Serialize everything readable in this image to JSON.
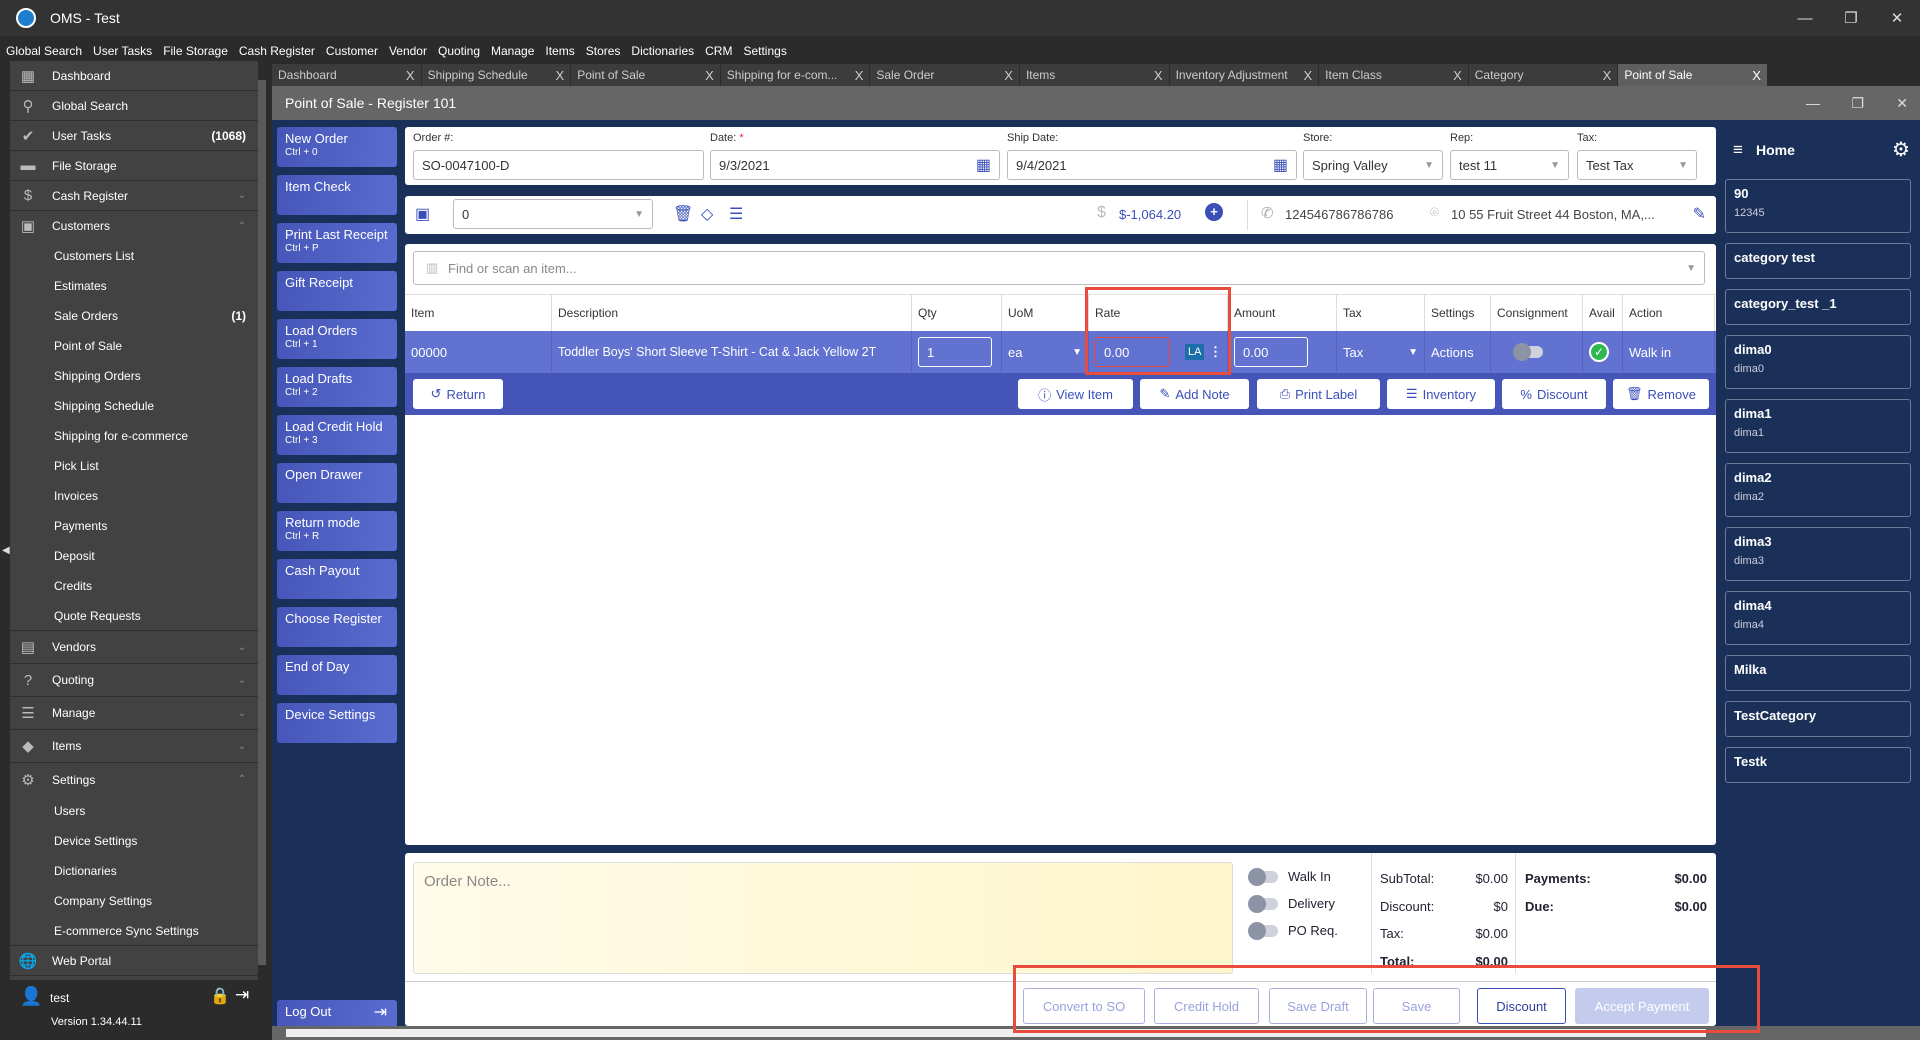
{
  "app": {
    "title": "OMS - Test"
  },
  "menu": [
    "Global Search",
    "User Tasks",
    "File Storage",
    "Cash Register",
    "Customer",
    "Vendor",
    "Quoting",
    "Manage",
    "Items",
    "Stores",
    "Dictionaries",
    "CRM",
    "Settings"
  ],
  "sidebar": {
    "items": [
      {
        "label": "Dashboard",
        "icon": "dashboard-icon",
        "glyph": "▦"
      },
      {
        "label": "Global Search",
        "icon": "search-icon",
        "glyph": "⚲"
      },
      {
        "label": "User Tasks",
        "icon": "check-circle-icon",
        "glyph": "✔",
        "count": "(1068)"
      },
      {
        "label": "File Storage",
        "icon": "folder-icon",
        "glyph": "▬"
      },
      {
        "label": "Cash Register",
        "icon": "dollar-icon",
        "glyph": "$",
        "chev": "⌄"
      }
    ],
    "customers": {
      "label": "Customers",
      "chev": "⌃",
      "subs": [
        "Customers List",
        "Estimates",
        "Sale Orders",
        "Point of Sale",
        "Shipping Orders",
        "Shipping Schedule",
        "Shipping for e-commerce",
        "Pick List",
        "Invoices",
        "Payments",
        "Deposit",
        "Credits",
        "Quote Requests"
      ],
      "sale_orders_count": "(1)"
    },
    "groups": [
      {
        "label": "Vendors",
        "glyph": "▤"
      },
      {
        "label": "Quoting",
        "glyph": "?"
      },
      {
        "label": "Manage",
        "glyph": "☰"
      },
      {
        "label": "Items",
        "glyph": "◆"
      }
    ],
    "settings": {
      "label": "Settings",
      "chev": "⌃",
      "subs": [
        "Users",
        "Device Settings",
        "Dictionaries",
        "Company Settings",
        "E-commerce Sync Settings"
      ]
    },
    "web_portal": "Web Portal",
    "user": "test",
    "version": "Version 1.34.44.11"
  },
  "tabs": [
    "Dashboard",
    "Shipping Schedule",
    "Point of Sale",
    "Shipping for e-com...",
    "Sale Order",
    "Items",
    "Inventory Adjustment",
    "Item Class",
    "Category",
    "Point of Sale"
  ],
  "window": {
    "title": "Point of Sale - Register 101"
  },
  "left_buttons": [
    {
      "label": "New Order",
      "sc": "Ctrl + 0"
    },
    {
      "label": "Item Check",
      "sc": ""
    },
    {
      "label": "Print Last Receipt",
      "sc": "Ctrl + P"
    },
    {
      "label": "Gift Receipt",
      "sc": ""
    },
    {
      "label": "Load Orders",
      "sc": "Ctrl + 1"
    },
    {
      "label": "Load Drafts",
      "sc": "Ctrl + 2"
    },
    {
      "label": "Load Credit Hold",
      "sc": "Ctrl + 3"
    },
    {
      "label": "Open Drawer",
      "sc": ""
    },
    {
      "label": "Return mode",
      "sc": "Ctrl + R"
    },
    {
      "label": "Cash Payout",
      "sc": ""
    },
    {
      "label": "Choose Register",
      "sc": ""
    },
    {
      "label": "End of Day",
      "sc": ""
    },
    {
      "label": "Device Settings",
      "sc": ""
    }
  ],
  "logout": "Log Out",
  "header": {
    "order_label": "Order #:",
    "order": "SO-0047100-D",
    "date_label": "Date:",
    "required": "*",
    "date": "9/3/2021",
    "ship_label": "Ship Date:",
    "ship": "9/4/2021",
    "store_label": "Store:",
    "store": "Spring Valley",
    "rep_label": "Rep:",
    "rep": "test 11",
    "tax_label": "Tax:",
    "tax": "Test Tax"
  },
  "customer": {
    "value": "0",
    "balance": "$-1,064.20",
    "phone": "124546786786786",
    "address": "10 55 Fruit Street 44 Boston, MA,..."
  },
  "search": {
    "placeholder": "Find or scan an item..."
  },
  "table": {
    "headers": [
      "Item",
      "Description",
      "Qty",
      "UoM",
      "Rate",
      "Amount",
      "Tax",
      "Settings",
      "Consignment",
      "Avail",
      "Action"
    ],
    "row": {
      "item": "00000",
      "description": "Toddler Boys' Short Sleeve T-Shirt - Cat & Jack Yellow 2T",
      "qty": "1",
      "uom": "ea",
      "rate": "0.00",
      "rate_badge": "LA",
      "amount": "0.00",
      "tax": "Tax",
      "settings": "Actions",
      "action": "Walk in"
    }
  },
  "row_actions": {
    "return": "Return",
    "view": "View Item",
    "note": "Add Note",
    "print": "Print Label",
    "inventory": "Inventory",
    "discount": "Discount",
    "remove": "Remove"
  },
  "note": {
    "placeholder": "Order Note..."
  },
  "toggles": [
    "Walk In",
    "Delivery",
    "PO Req."
  ],
  "totals": {
    "subtotal_label": "SubTotal:",
    "subtotal": "$0.00",
    "discount_label": "Discount:",
    "discount": "$0",
    "tax_label": "Tax:",
    "tax": "$0.00",
    "total_label": "Total:",
    "total": "$0.00",
    "payments_label": "Payments:",
    "payments": "$0.00",
    "due_label": "Due:",
    "due": "$0.00"
  },
  "bottom_buttons": {
    "convert": "Convert to SO",
    "credit": "Credit Hold",
    "draft": "Save Draft",
    "save": "Save",
    "discount": "Discount",
    "accept": "Accept Payment"
  },
  "right_panel": {
    "title": "Home",
    "cards": [
      {
        "t": "90",
        "s": "12345"
      },
      {
        "t": "category test",
        "s": ""
      },
      {
        "t": "category_test _1",
        "s": ""
      },
      {
        "t": "dima0",
        "s": "dima0"
      },
      {
        "t": "dima1",
        "s": "dima1"
      },
      {
        "t": "dima2",
        "s": "dima2"
      },
      {
        "t": "dima3",
        "s": "dima3"
      },
      {
        "t": "dima4",
        "s": "dima4"
      },
      {
        "t": "Milka",
        "s": ""
      },
      {
        "t": "TestCategory",
        "s": ""
      },
      {
        "t": "Testk",
        "s": ""
      }
    ]
  }
}
